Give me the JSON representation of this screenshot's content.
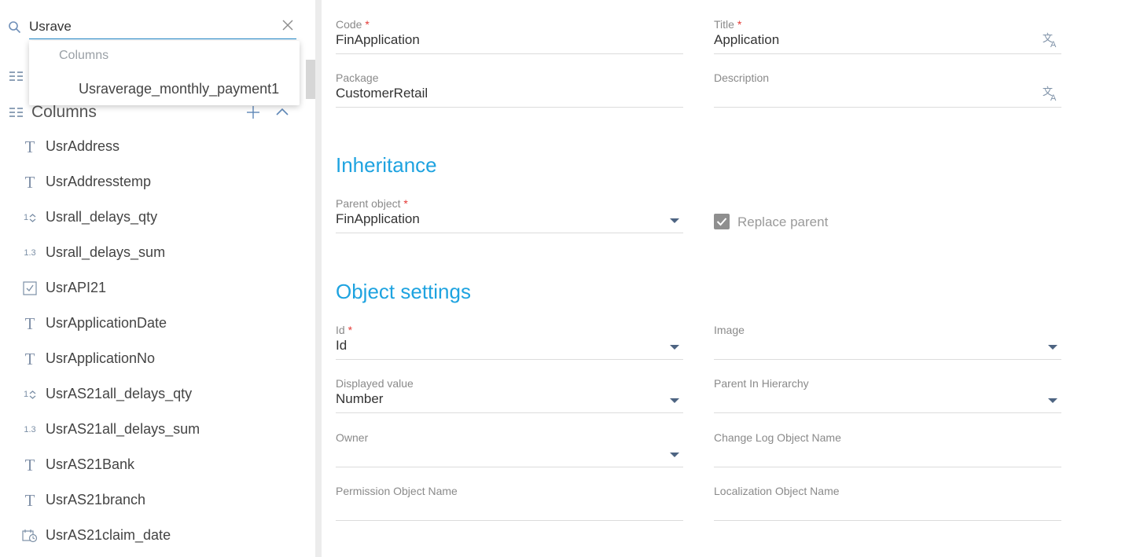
{
  "search": {
    "value": "Usrave",
    "placeholder": ""
  },
  "suggestions": {
    "header": "Columns",
    "items": [
      "Usraverage_monthly_payment1"
    ]
  },
  "columns_panel": {
    "title": "Columns",
    "items": [
      {
        "label": "UsrAddress",
        "type": "text-icon"
      },
      {
        "label": "UsrAddresstemp",
        "type": "text-icon"
      },
      {
        "label": "Usrall_delays_qty",
        "type": "integer-icon"
      },
      {
        "label": "Usrall_delays_sum",
        "type": "decimal-icon"
      },
      {
        "label": "UsrAPI21",
        "type": "boolean-icon"
      },
      {
        "label": "UsrApplicationDate",
        "type": "text-icon"
      },
      {
        "label": "UsrApplicationNo",
        "type": "text-icon"
      },
      {
        "label": "UsrAS21all_delays_qty",
        "type": "integer-icon"
      },
      {
        "label": "UsrAS21all_delays_sum",
        "type": "decimal-icon"
      },
      {
        "label": "UsrAS21Bank",
        "type": "text-icon"
      },
      {
        "label": "UsrAS21branch",
        "type": "text-icon"
      },
      {
        "label": "UsrAS21claim_date",
        "type": "datetime-icon"
      }
    ],
    "icon_text": {
      "integer": "1",
      "decimal": "1.3"
    }
  },
  "fields": {
    "code": {
      "label": "Code",
      "required": "*",
      "value": "FinApplication"
    },
    "title": {
      "label": "Title",
      "required": "*",
      "value": "Application"
    },
    "package": {
      "label": "Package",
      "value": "CustomerRetail"
    },
    "description": {
      "label": "Description",
      "value": ""
    },
    "parent_object": {
      "label": "Parent object",
      "required": "*",
      "value": "FinApplication"
    },
    "replace_parent": {
      "label": "Replace parent",
      "checked": true
    },
    "id": {
      "label": "Id",
      "required": "*",
      "value": "Id"
    },
    "image": {
      "label": "Image",
      "value": ""
    },
    "displayed_value": {
      "label": "Displayed value",
      "value": "Number"
    },
    "parent_in_hierarchy": {
      "label": "Parent In Hierarchy",
      "value": ""
    },
    "owner": {
      "label": "Owner",
      "value": ""
    },
    "change_log_object_name": {
      "label": "Change Log Object Name",
      "value": ""
    },
    "permission_object_name": {
      "label": "Permission Object Name",
      "value": ""
    },
    "localization_object_name": {
      "label": "Localization Object Name",
      "value": ""
    }
  },
  "sections": {
    "inheritance": "Inheritance",
    "object_settings": "Object settings"
  },
  "colors": {
    "accent": "#1ea3e0",
    "required": "#e53935",
    "search_underline": "#1e88c9"
  }
}
